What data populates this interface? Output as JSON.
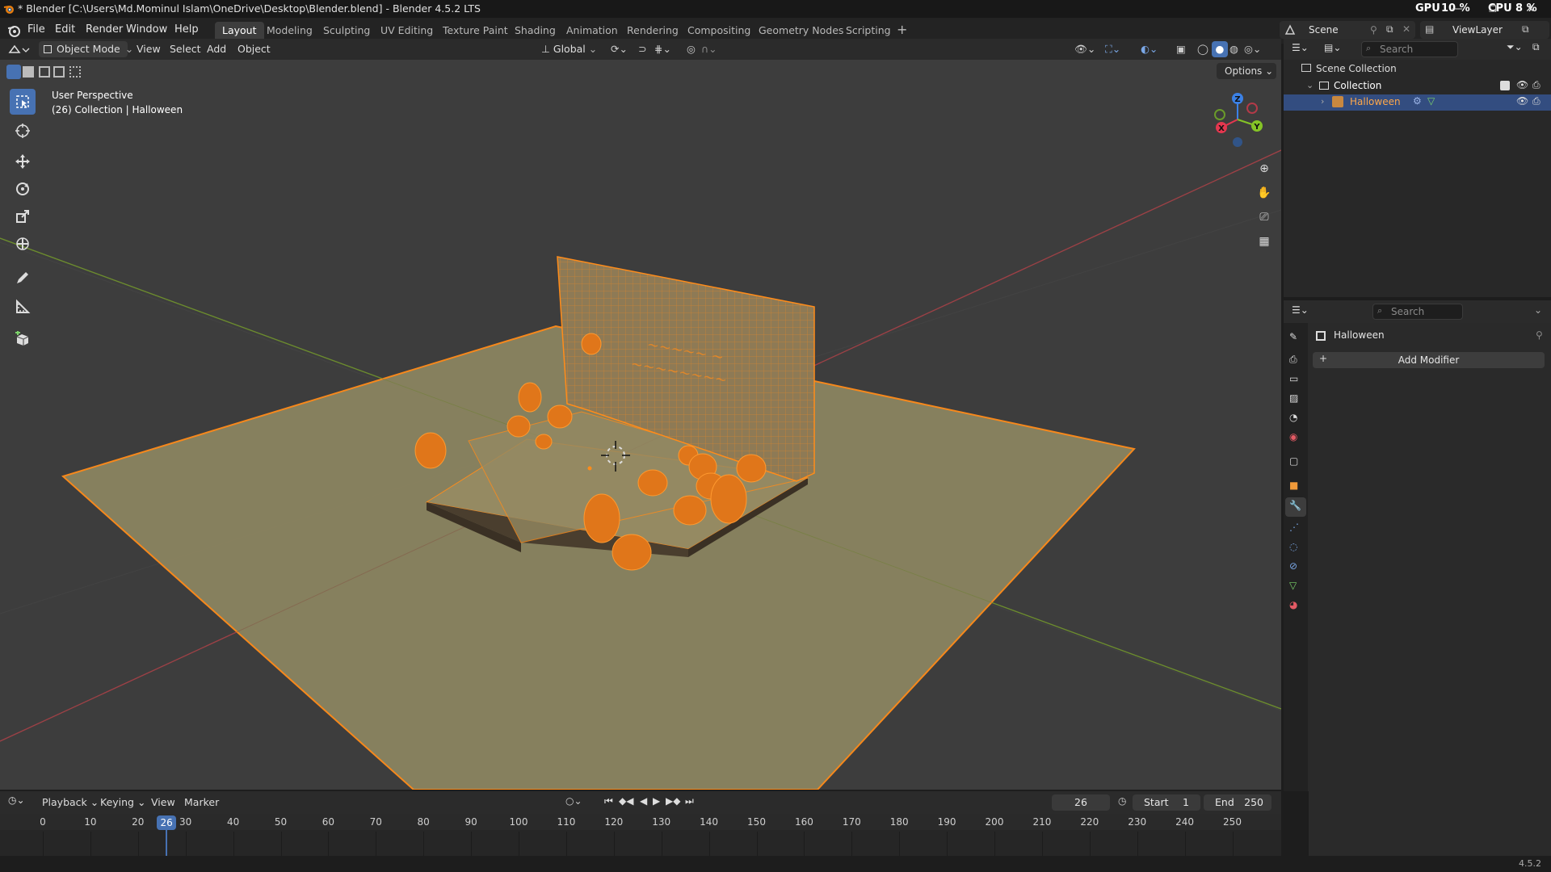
{
  "window": {
    "title": "* Blender [C:\\Users\\Md.Mominul Islam\\OneDrive\\Desktop\\Blender.blend] - Blender 4.5.2 LTS",
    "gpu_label": "GPU",
    "gpu_value": "10 %",
    "cpu_label": "CPU",
    "cpu_value": "8 %"
  },
  "menu": [
    "File",
    "Edit",
    "Render",
    "Window",
    "Help"
  ],
  "workspaces": [
    "Layout",
    "Modeling",
    "Sculpting",
    "UV Editing",
    "Texture Paint",
    "Shading",
    "Animation",
    "Rendering",
    "Compositing",
    "Geometry Nodes",
    "Scripting"
  ],
  "active_workspace": "Layout",
  "scene_name": "Scene",
  "view_layer": "ViewLayer",
  "viewport_header": {
    "mode": "Object Mode",
    "menus": [
      "View",
      "Select",
      "Add",
      "Object"
    ],
    "orientation": "Global",
    "options": "Options"
  },
  "viewport_overlay": {
    "line1": "User Perspective",
    "line2": "(26) Collection | Halloween"
  },
  "gizmo": {
    "x": "X",
    "y": "Y",
    "z": "Z"
  },
  "outliner": {
    "search_placeholder": "Search",
    "scene_collection": "Scene Collection",
    "collection": "Collection",
    "object": "Halloween"
  },
  "properties": {
    "search_placeholder": "Search",
    "object_name": "Halloween",
    "add_modifier": "Add Modifier"
  },
  "timeline": {
    "menus": [
      "Playback",
      "Keying",
      "View",
      "Marker"
    ],
    "current_frame": "26",
    "start_label": "Start",
    "start_value": "1",
    "end_label": "End",
    "end_value": "250",
    "ticks": [
      "0",
      "10",
      "20",
      "30",
      "40",
      "50",
      "60",
      "70",
      "80",
      "90",
      "100",
      "110",
      "120",
      "130",
      "140",
      "150",
      "160",
      "170",
      "180",
      "190",
      "200",
      "210",
      "220",
      "230",
      "240",
      "250"
    ]
  },
  "status": {
    "version": "4.5.2"
  },
  "colors": {
    "accent": "#4772b3",
    "selection": "#ff8c1a",
    "ground": "#8a8360",
    "x_axis": "#e4374f",
    "y_axis": "#85c426",
    "z_axis": "#3b81e6"
  }
}
